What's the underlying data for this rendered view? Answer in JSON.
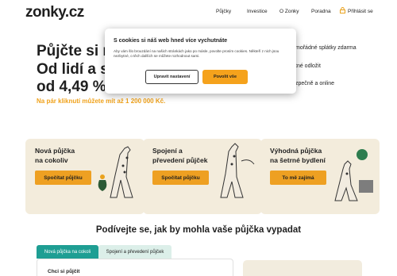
{
  "header": {
    "logo": "zonky.cz",
    "nav": [
      "Půjčky",
      "Investice",
      "O Zonky",
      "Poradna"
    ],
    "login_label": "Přihlásit se"
  },
  "hero": {
    "line1": "Půjčte si n",
    "line2": "Od lidí a s",
    "line3": "od 4,49 %",
    "subtitle": "Na pár kliknutí můžete mít až 1 200 000 Kč.",
    "features": [
      "mořádné splátky zdarma",
      "tné odložit",
      "zpečně a online"
    ]
  },
  "cookie": {
    "title": "S cookies si náš web hned více vychutnáte",
    "text": "Aby vám šlo brouzdání na našich stránkách jako po másle, povolte prosím cookies. Někteří z nich jsou nezbytné, o těch dalších se můžete rozhodnout sami.",
    "customize_label": "Upravit nastavení",
    "allow_label": "Povolit vše"
  },
  "cards": [
    {
      "title_l1": "Nová půjčka",
      "title_l2": "na cokoliv",
      "button": "Spočítat půjčku"
    },
    {
      "title_l1": "Spojení a",
      "title_l2": "převedení půjček",
      "button": "Spočítat půjčku"
    },
    {
      "title_l1": "Výhodná půjčka",
      "title_l2": "na šetrné bydlení",
      "button": "To mě zajímá"
    }
  ],
  "calculator": {
    "heading": "Podívejte se, jak by mohla vaše půjčka vypadat",
    "tabs": [
      "Nová půjčka na cokoli",
      "Spojení a převedení půjček"
    ],
    "field_label": "Chci si půjčit"
  },
  "colors": {
    "accent": "#f0a21b",
    "card_bg": "#f3ecdc",
    "tab_active": "#1e9e93",
    "tab_inactive": "#dcefe9"
  }
}
